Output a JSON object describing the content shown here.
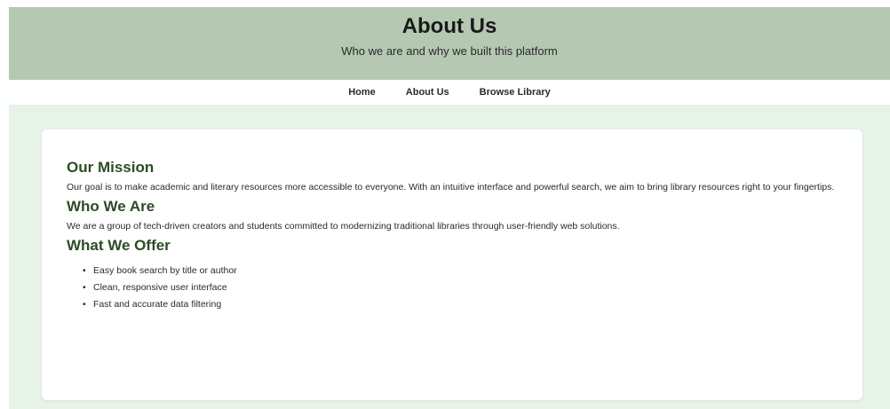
{
  "header": {
    "title": "About Us",
    "subtitle": "Who we are and why we built this platform"
  },
  "nav": {
    "items": [
      {
        "label": "Home"
      },
      {
        "label": "About Us"
      },
      {
        "label": "Browse Library"
      }
    ]
  },
  "content": {
    "mission": {
      "heading": "Our Mission",
      "text": "Our goal is to make academic and literary resources more accessible to everyone. With an intuitive interface and powerful search, we aim to bring library resources right to your fingertips."
    },
    "who": {
      "heading": "Who We Are",
      "text": "We are a group of tech-driven creators and students committed to modernizing traditional libraries through user-friendly web solutions."
    },
    "offer": {
      "heading": "What We Offer",
      "items": [
        "Easy book search by title or author",
        "Clean, responsive user interface",
        "Fast and accurate data filtering"
      ]
    }
  },
  "colors": {
    "header_bg": "#b5c9b2",
    "body_bg": "#e8f3e7",
    "heading": "#2b4d24"
  }
}
